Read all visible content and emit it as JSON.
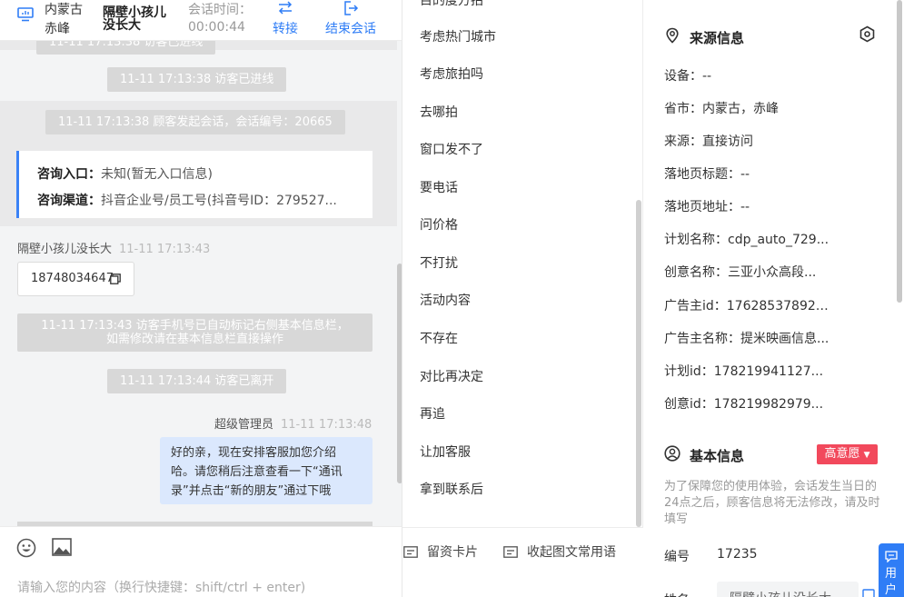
{
  "header": {
    "location_line1": "内蒙古",
    "location_line2": "赤峰",
    "name_line1": "隔壁小孩儿",
    "name_line2": "没长大",
    "session_time_label": "会话时间：",
    "session_time": "00:00:44",
    "transfer_label": "转接",
    "end_label": "结束会话"
  },
  "chat": {
    "sys_entered": "11-11 17:13:38 访客已进线",
    "sys_started": "11-11 17:13:38 顾客发起会话，会话编号：20665",
    "card_entry_label": "咨询入口：",
    "card_entry_value": "未知(暂无入口信息)",
    "card_channel_label": "咨询渠道：",
    "card_channel_value": "抖音企业号/员工号(抖音号ID：279527...",
    "visitor_name": "隔壁小孩儿没长大",
    "visitor_time": "11-11 17:13:43",
    "phone": "18748034647",
    "sys_phone_line1": "11-11 17:13:43 访客手机号已自动标记右侧基本信息栏，",
    "sys_phone_line2": "如需修改请在基本信息栏直接操作",
    "sys_left": "11-11 17:13:44 访客已离开",
    "agent_name": "超级管理员",
    "agent_time": "11-11 17:13:48",
    "reply_line1": "好的亲，现在安排客服加您介绍",
    "reply_line2": "哈。请您稍后注意查看一下“通讯",
    "reply_line3": "录”并点击“新的朋友”通过下哦"
  },
  "composer": {
    "placeholder": "请输入您的内容（换行快捷键：shift/ctrl + enter)"
  },
  "phrases": [
    "考虑热门城市",
    "考虑旅拍吗",
    "去哪拍",
    "窗口发不了",
    "要电话",
    "问价格",
    "不打扰",
    "活动内容",
    "不存在",
    "对比再决定",
    "再追",
    "让加客服",
    "拿到联系后"
  ],
  "phrase_footer": {
    "card_label": "留资卡片",
    "collapse_label": "收起图文常用语"
  },
  "source_info": {
    "title": "来源信息",
    "device": "设备：--",
    "province": "省市：内蒙古，赤峰",
    "source": "来源：直接访问",
    "landing_title": "落地页标题：--",
    "landing_url": "落地页地址：--",
    "plan_name": "计划名称：cdp_auto_729...",
    "creative_name": "创意名称：三亚小众高段...",
    "advertiser_id": "广告主id：176285378923...",
    "advertiser_name": "广告主名称：提米映画信息...",
    "plan_id": "计划id：178219941127...",
    "creative_id": "创意id：178219982979..."
  },
  "basic_info": {
    "title": "基本信息",
    "intent_badge": "高意愿",
    "notice": "为了保障您的使用体验，会话发生当日的24点之后，顾客信息将无法修改，请及时填写",
    "number_label": "编号",
    "number_value": "17235",
    "name_label": "姓名",
    "name_value": "隔壁小孩儿没长大"
  },
  "float_button": {
    "label_line1": "用",
    "label_line2": "户"
  },
  "colors": {
    "accent": "#2f7df6",
    "badge": "#f2495c",
    "bubble": "#dbe8fd"
  }
}
